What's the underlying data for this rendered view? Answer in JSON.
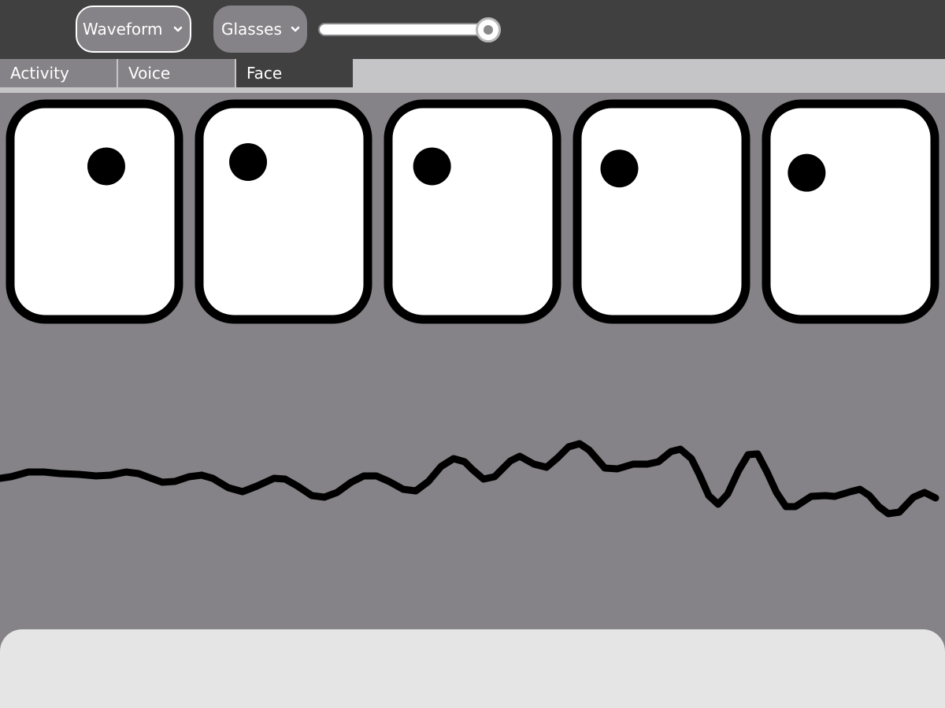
{
  "toolbar": {
    "mode_select": {
      "value": "Waveform"
    },
    "face_select": {
      "value": "Glasses"
    },
    "slider": {
      "value_fraction": 1.0
    }
  },
  "tabs": [
    {
      "label": "Activity",
      "active": false
    },
    {
      "label": "Voice",
      "active": false
    },
    {
      "label": "Face",
      "active": true
    }
  ],
  "eyes": [
    {
      "pupil": [
        0.57,
        0.29
      ]
    },
    {
      "pupil": [
        0.29,
        0.27
      ]
    },
    {
      "pupil": [
        0.26,
        0.29
      ]
    },
    {
      "pupil": [
        0.25,
        0.3
      ]
    },
    {
      "pupil": [
        0.24,
        0.32
      ]
    }
  ],
  "colors": {
    "toolbar_bg": "#404040",
    "canvas_bg": "#858387",
    "tabbar_bg": "#c5c4c7",
    "bottom_panel": "#e5e5e5",
    "eye_fill": "#ffffff",
    "ink": "#000000"
  }
}
